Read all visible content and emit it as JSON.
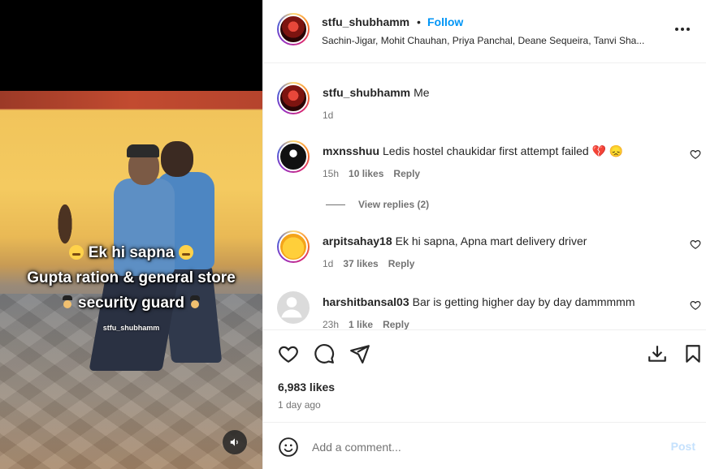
{
  "media": {
    "caption_line1": "Ek hi sapna",
    "caption_line2": "Gupta ration & general store",
    "caption_line3": "security guard",
    "watermark": "stfu_shubhamm"
  },
  "header": {
    "username": "stfu_shubhamm",
    "dot": "•",
    "follow_label": "Follow",
    "audio": "Sachin-Jigar, Mohit Chauhan, Priya Panchal, Deane Sequeira, Tanvi Sha..."
  },
  "caption": {
    "username": "stfu_shubhamm",
    "text": "Me",
    "time": "1d"
  },
  "comments": [
    {
      "username": "mxnsshuu",
      "text": "Ledis hostel chaukidar first attempt failed 💔 😞",
      "time": "15h",
      "likes": "10 likes",
      "reply": "Reply"
    },
    {
      "username": "arpitsahay18",
      "text": "Ek hi sapna, Apna mart delivery driver",
      "time": "1d",
      "likes": "37 likes",
      "reply": "Reply"
    },
    {
      "username": "harshitbansal03",
      "text": "Bar is getting higher day by day dammmmm",
      "time": "23h",
      "likes": "1 like",
      "reply": "Reply"
    }
  ],
  "view_replies": "View replies (2)",
  "actions": {
    "likes": "6,983 likes",
    "posted_ago": "1 day ago"
  },
  "composer": {
    "placeholder": "Add a comment...",
    "post_label": "Post"
  },
  "colors": {
    "accent": "#0095f6",
    "post_disabled": "#c5e1fd",
    "muted": "#737373"
  }
}
